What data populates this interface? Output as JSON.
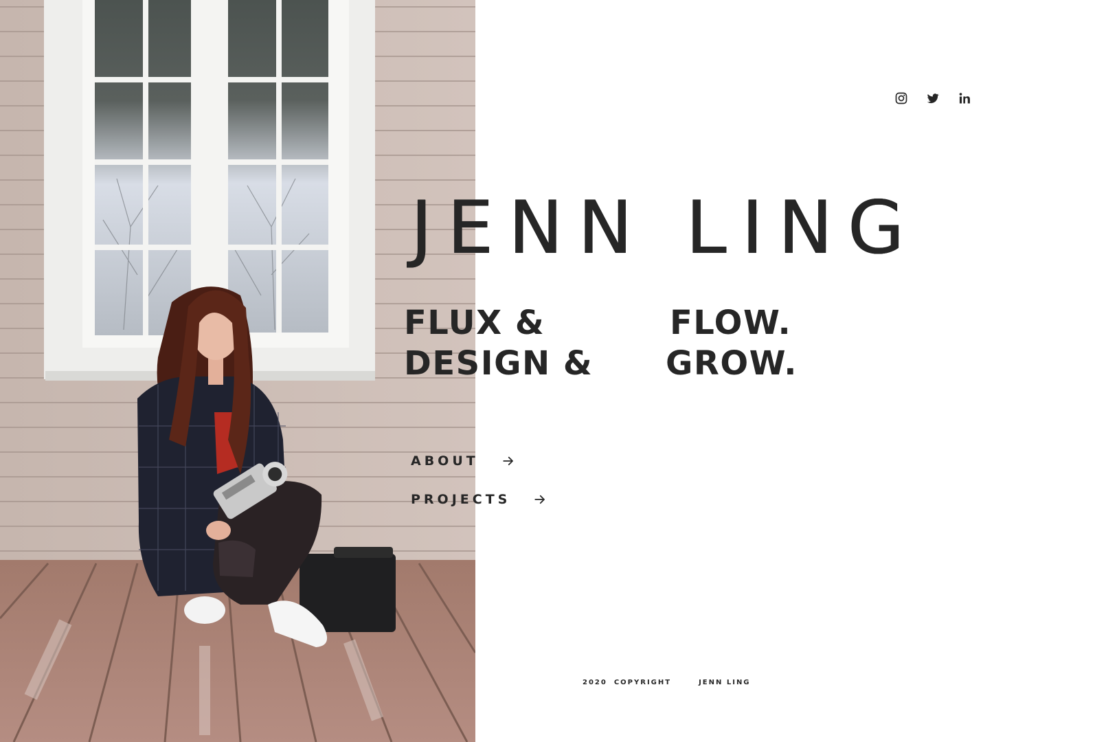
{
  "site": {
    "name": "JENN LING"
  },
  "social": [
    {
      "icon": "instagram-icon",
      "label": "Instagram"
    },
    {
      "icon": "twitter-icon",
      "label": "Twitter"
    },
    {
      "icon": "linkedin-icon",
      "label": "LinkedIn"
    }
  ],
  "tagline": {
    "line1_left": "FLUX &",
    "line1_right": "FLOW.",
    "line2_left": "DESIGN &",
    "line2_right": "GROW."
  },
  "nav": [
    {
      "label": "ABOUT",
      "icon": "arrow-right-icon"
    },
    {
      "label": "PROJECTS",
      "icon": "arrow-right-icon"
    }
  ],
  "footer": {
    "year": "2020",
    "copyright": "COPYRIGHT",
    "owner": "JENN LING"
  },
  "colors": {
    "text": "#262626",
    "background": "#ffffff"
  }
}
